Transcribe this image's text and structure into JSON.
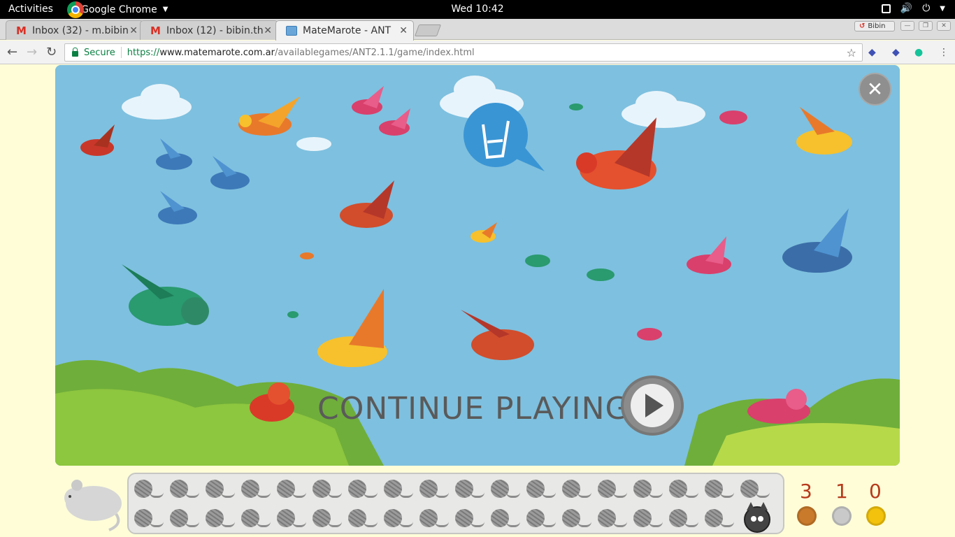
{
  "topbar": {
    "activities": "Activities",
    "app_name": "Google Chrome",
    "clock": "Wed 10:42"
  },
  "tabs": [
    {
      "label": "Inbox (32) - m.bibin",
      "icon": "gmail-icon"
    },
    {
      "label": "Inbox (12) - bibin.th",
      "icon": "gmail-icon"
    },
    {
      "label": "MateMarote - ANT",
      "icon": "matemarote-icon"
    }
  ],
  "profile_name": "Bibin",
  "address_bar": {
    "secure_label": "Secure",
    "scheme": "https://",
    "host": "www.matemarote.com.ar",
    "path": "/availablegames/ANT2.1.1/game/index.html"
  },
  "game": {
    "continue_label": "CONTINUE PLAYING",
    "progress": {
      "total_yarn": 36,
      "row1_count": 18,
      "row2_count": 18
    },
    "scores": [
      {
        "value": "3",
        "medal": "bronze",
        "color": "#c97a2a"
      },
      {
        "value": "1",
        "medal": "silver",
        "color": "#c9c9c9"
      },
      {
        "value": "0",
        "medal": "gold",
        "color": "#f2c20c"
      }
    ]
  },
  "colors": {
    "sky": "#7ec0df",
    "secure_green": "#0b8043",
    "score_red": "#b73a1a",
    "page_bg": "#fefdd8"
  }
}
